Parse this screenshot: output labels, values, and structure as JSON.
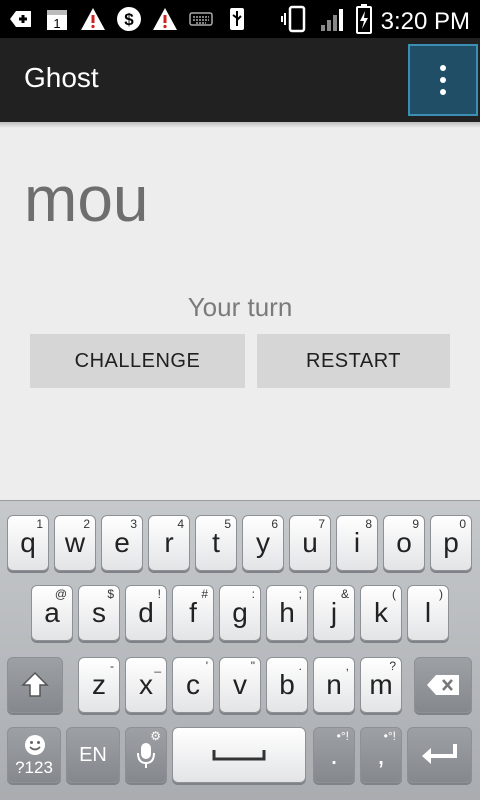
{
  "status_bar": {
    "time": "3:20 PM",
    "icons": [
      "add-icon",
      "calendar-icon",
      "warning-icon",
      "dollar-icon",
      "warning-icon",
      "keyboard-icon",
      "usb-icon",
      "vibrate-icon",
      "signal-icon",
      "battery-charging-icon"
    ],
    "calendar_day": "1"
  },
  "app_bar": {
    "title": "Ghost",
    "overflow_icon": "more-vert-icon"
  },
  "game": {
    "word": "mou",
    "status": "Your turn",
    "challenge_label": "CHALLENGE",
    "restart_label": "RESTART"
  },
  "keyboard": {
    "row1": [
      {
        "key": "q",
        "hint": "1"
      },
      {
        "key": "w",
        "hint": "2"
      },
      {
        "key": "e",
        "hint": "3"
      },
      {
        "key": "r",
        "hint": "4"
      },
      {
        "key": "t",
        "hint": "5"
      },
      {
        "key": "y",
        "hint": "6"
      },
      {
        "key": "u",
        "hint": "7"
      },
      {
        "key": "i",
        "hint": "8"
      },
      {
        "key": "o",
        "hint": "9"
      },
      {
        "key": "p",
        "hint": "0"
      }
    ],
    "row2": [
      {
        "key": "a",
        "hint": "@"
      },
      {
        "key": "s",
        "hint": "$"
      },
      {
        "key": "d",
        "hint": "!"
      },
      {
        "key": "f",
        "hint": "#"
      },
      {
        "key": "g",
        "hint": ":"
      },
      {
        "key": "h",
        "hint": ";"
      },
      {
        "key": "j",
        "hint": "&"
      },
      {
        "key": "k",
        "hint": "("
      },
      {
        "key": "l",
        "hint": ")"
      }
    ],
    "row3": [
      {
        "key": "z",
        "hint": "-"
      },
      {
        "key": "x",
        "hint": "_"
      },
      {
        "key": "c",
        "hint": "'"
      },
      {
        "key": "v",
        "hint": "\""
      },
      {
        "key": "b",
        "hint": "."
      },
      {
        "key": "n",
        "hint": ","
      },
      {
        "key": "m",
        "hint": "?"
      }
    ],
    "symbols_label": "?123",
    "language_label": "EN",
    "period": ".",
    "comma": ",",
    "period_hint": "•°!",
    "comma_hint": "•°!"
  },
  "colors": {
    "app_bar": "#212121",
    "overflow_highlight": "#1f4e66",
    "background": "#ededed",
    "button": "#d6d6d6"
  }
}
